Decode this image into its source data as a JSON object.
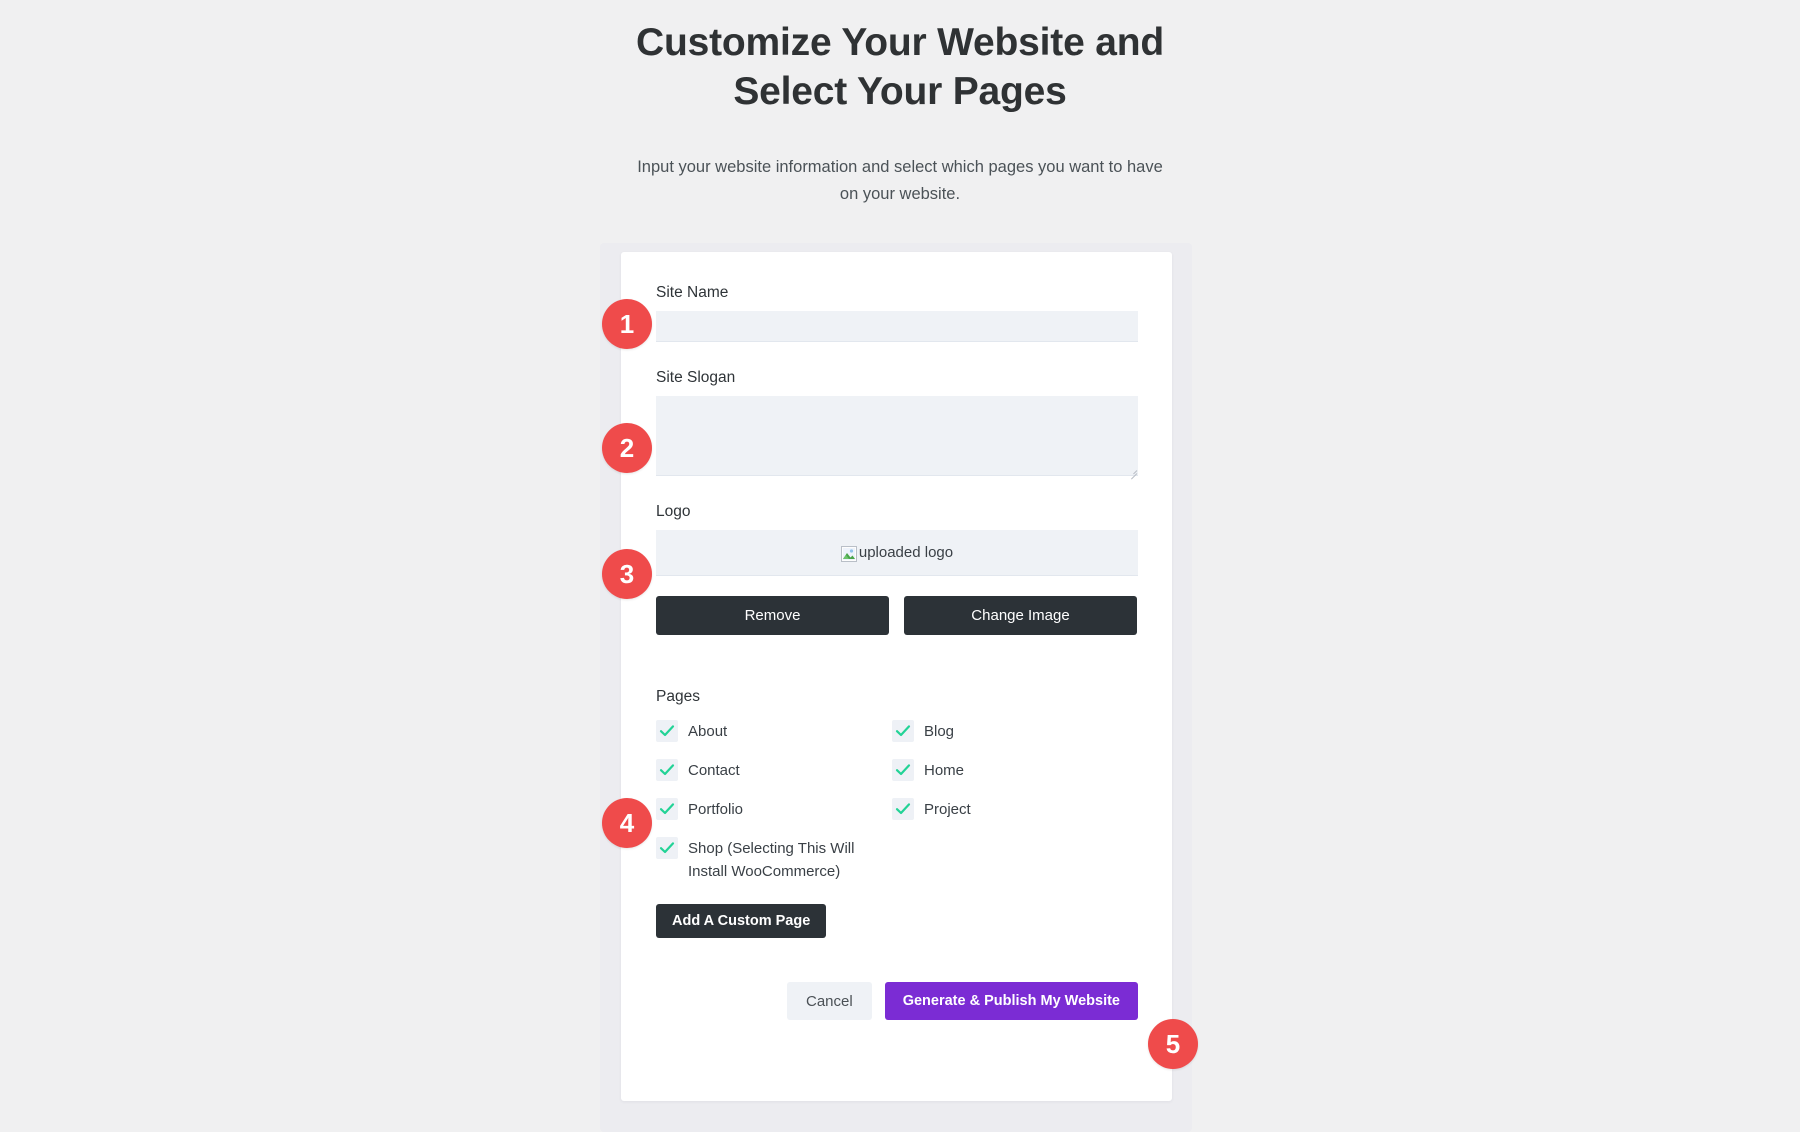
{
  "header": {
    "title": "Customize Your Website and Select Your Pages",
    "subtitle": "Input your website information and select which pages you want to have on your website."
  },
  "form": {
    "site_name": {
      "label": "Site Name",
      "value": "",
      "placeholder": ""
    },
    "site_slogan": {
      "label": "Site Slogan",
      "value": "",
      "placeholder": ""
    },
    "logo": {
      "label": "Logo",
      "alt_text": "uploaded logo",
      "icon": "broken-image-icon",
      "remove_label": "Remove",
      "change_label": "Change Image"
    }
  },
  "pages": {
    "label": "Pages",
    "items": [
      {
        "label": "About",
        "checked": true
      },
      {
        "label": "Blog",
        "checked": true
      },
      {
        "label": "Contact",
        "checked": true
      },
      {
        "label": "Home",
        "checked": true
      },
      {
        "label": "Portfolio",
        "checked": true
      },
      {
        "label": "Project",
        "checked": true
      },
      {
        "label": "Shop (Selecting This Will Install WooCommerce)",
        "checked": true
      }
    ],
    "add_custom_page_label": "Add A Custom Page"
  },
  "footer": {
    "cancel_label": "Cancel",
    "publish_label": "Generate & Publish My Website"
  },
  "badges": [
    {
      "number": "1"
    },
    {
      "number": "2"
    },
    {
      "number": "3"
    },
    {
      "number": "4"
    },
    {
      "number": "5"
    }
  ],
  "colors": {
    "page_background": "#f0f0f1",
    "card_background": "#ffffff",
    "card_outer": "#ececf0",
    "input_background": "#eff2f6",
    "dark_button": "#2c3237",
    "accent_purple": "#7b2cd4",
    "badge_red": "#ef4b4b",
    "check_green": "#22d396",
    "heading_text": "#2f3234",
    "body_text": "#4b5257"
  }
}
